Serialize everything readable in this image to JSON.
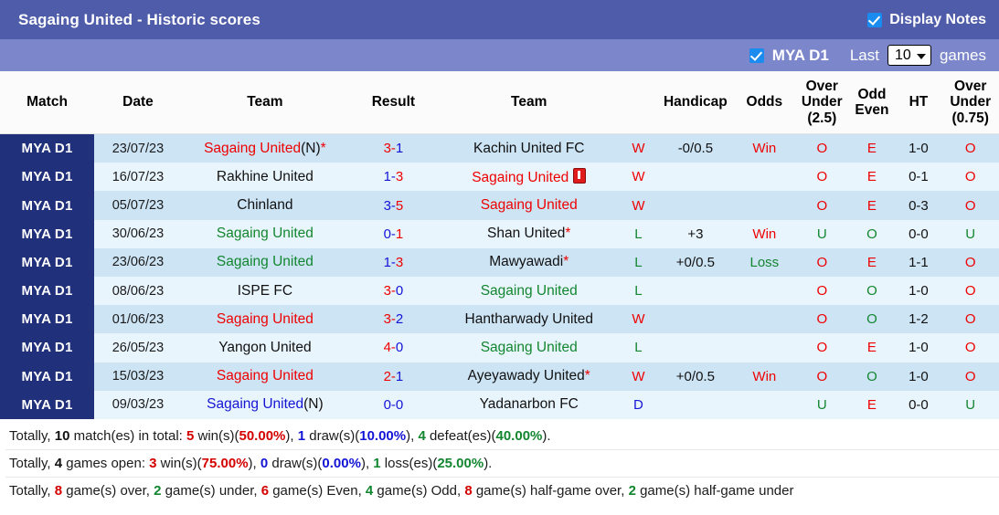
{
  "header": {
    "title": "Sagaing United - Historic scores",
    "display_notes_label": "Display Notes",
    "league_label": "MYA D1",
    "last_label": "Last",
    "games_label": "games",
    "games_count": "10",
    "title_bar_color": "#4e5ca9",
    "sub_bar_color": "#7b86cb",
    "checkbox_color": "#1a8cf0"
  },
  "columns": [
    {
      "label": "Match"
    },
    {
      "label": "Date"
    },
    {
      "label": "Team"
    },
    {
      "label": "Result"
    },
    {
      "label": "Team"
    },
    {
      "label": ""
    },
    {
      "label": "Handicap"
    },
    {
      "label": "Odds"
    },
    {
      "label": "Over\nUnder\n(2.5)",
      "l1": "Over",
      "l2": "Under",
      "l3": "(2.5)"
    },
    {
      "label": "Odd\nEven",
      "l1": "Odd",
      "l2": "Even"
    },
    {
      "label": "HT"
    },
    {
      "label": "Over\nUnder\n(0.75)",
      "l1": "Over",
      "l2": "Under",
      "l3": "(0.75)"
    }
  ],
  "column_labels": {
    "match": "Match",
    "date": "Date",
    "team": "Team",
    "result": "Result",
    "team2": "Team",
    "handicap": "Handicap",
    "odds": "Odds",
    "ou25_1": "Over",
    "ou25_2": "Under",
    "ou25_3": "(2.5)",
    "oddeven_1": "Odd",
    "oddeven_2": "Even",
    "ht": "HT",
    "ou075_1": "Over",
    "ou075_2": "Under",
    "ou075_3": "(0.75)"
  },
  "colors": {
    "red": "#ee0000",
    "green": "#12862f",
    "blue": "#1414d6",
    "black": "#111111",
    "league_cell": "#20307a",
    "row_odd": "#cde4f5",
    "row_even": "#e9f5fd"
  },
  "rows": [
    {
      "league": "MYA D1",
      "date": "23/07/23",
      "home": "Sagaing United",
      "home_color": "red",
      "home_suffix": "(N)",
      "home_suffix_color": "black",
      "home_star": true,
      "home_card": false,
      "score_home": "3",
      "score_away": "1",
      "score_home_color": "red",
      "score_away_color": "blue",
      "away": "Kachin United FC",
      "away_color": "black",
      "away_suffix": "",
      "away_star": false,
      "away_card": false,
      "wdl": "W",
      "wdl_color": "red",
      "handicap": "-0/0.5",
      "odds": "Win",
      "odds_color": "red",
      "ou25": "O",
      "ou25_color": "red",
      "oddeven": "E",
      "oddeven_color": "red",
      "ht": "1-0",
      "ou075": "O",
      "ou075_color": "red"
    },
    {
      "league": "MYA D1",
      "date": "16/07/23",
      "home": "Rakhine United",
      "home_color": "black",
      "home_suffix": "",
      "home_star": false,
      "home_card": false,
      "score_home": "1",
      "score_away": "3",
      "score_home_color": "blue",
      "score_away_color": "red",
      "away": "Sagaing United",
      "away_color": "red",
      "away_suffix": "",
      "away_star": false,
      "away_card": true,
      "wdl": "W",
      "wdl_color": "red",
      "handicap": "",
      "odds": "",
      "odds_color": "black",
      "ou25": "O",
      "ou25_color": "red",
      "oddeven": "E",
      "oddeven_color": "red",
      "ht": "0-1",
      "ou075": "O",
      "ou075_color": "red"
    },
    {
      "league": "MYA D1",
      "date": "05/07/23",
      "home": "Chinland",
      "home_color": "black",
      "home_suffix": "",
      "home_star": false,
      "home_card": false,
      "score_home": "3",
      "score_away": "5",
      "score_home_color": "blue",
      "score_away_color": "red",
      "away": "Sagaing United",
      "away_color": "red",
      "away_suffix": "",
      "away_star": false,
      "away_card": false,
      "wdl": "W",
      "wdl_color": "red",
      "handicap": "",
      "odds": "",
      "odds_color": "black",
      "ou25": "O",
      "ou25_color": "red",
      "oddeven": "E",
      "oddeven_color": "red",
      "ht": "0-3",
      "ou075": "O",
      "ou075_color": "red"
    },
    {
      "league": "MYA D1",
      "date": "30/06/23",
      "home": "Sagaing United",
      "home_color": "green",
      "home_suffix": "",
      "home_star": false,
      "home_card": false,
      "score_home": "0",
      "score_away": "1",
      "score_home_color": "blue",
      "score_away_color": "red",
      "away": "Shan United",
      "away_color": "black",
      "away_suffix": "",
      "away_star": true,
      "away_card": false,
      "wdl": "L",
      "wdl_color": "green",
      "handicap": "+3",
      "odds": "Win",
      "odds_color": "red",
      "ou25": "U",
      "ou25_color": "green",
      "oddeven": "O",
      "oddeven_color": "green",
      "ht": "0-0",
      "ou075": "U",
      "ou075_color": "green"
    },
    {
      "league": "MYA D1",
      "date": "23/06/23",
      "home": "Sagaing United",
      "home_color": "green",
      "home_suffix": "",
      "home_star": false,
      "home_card": false,
      "score_home": "1",
      "score_away": "3",
      "score_home_color": "blue",
      "score_away_color": "red",
      "away": "Mawyawadi",
      "away_color": "black",
      "away_suffix": "",
      "away_star": true,
      "away_card": false,
      "wdl": "L",
      "wdl_color": "green",
      "handicap": "+0/0.5",
      "odds": "Loss",
      "odds_color": "green",
      "ou25": "O",
      "ou25_color": "red",
      "oddeven": "E",
      "oddeven_color": "red",
      "ht": "1-1",
      "ou075": "O",
      "ou075_color": "red"
    },
    {
      "league": "MYA D1",
      "date": "08/06/23",
      "home": "ISPE FC",
      "home_color": "black",
      "home_suffix": "",
      "home_star": false,
      "home_card": false,
      "score_home": "3",
      "score_away": "0",
      "score_home_color": "red",
      "score_away_color": "blue",
      "away": "Sagaing United",
      "away_color": "green",
      "away_suffix": "",
      "away_star": false,
      "away_card": false,
      "wdl": "L",
      "wdl_color": "green",
      "handicap": "",
      "odds": "",
      "odds_color": "black",
      "ou25": "O",
      "ou25_color": "red",
      "oddeven": "O",
      "oddeven_color": "green",
      "ht": "1-0",
      "ou075": "O",
      "ou075_color": "red"
    },
    {
      "league": "MYA D1",
      "date": "01/06/23",
      "home": "Sagaing United",
      "home_color": "red",
      "home_suffix": "",
      "home_star": false,
      "home_card": false,
      "score_home": "3",
      "score_away": "2",
      "score_home_color": "red",
      "score_away_color": "blue",
      "away": "Hantharwady United",
      "away_color": "black",
      "away_suffix": "",
      "away_star": false,
      "away_card": false,
      "wdl": "W",
      "wdl_color": "red",
      "handicap": "",
      "odds": "",
      "odds_color": "black",
      "ou25": "O",
      "ou25_color": "red",
      "oddeven": "O",
      "oddeven_color": "green",
      "ht": "1-2",
      "ou075": "O",
      "ou075_color": "red"
    },
    {
      "league": "MYA D1",
      "date": "26/05/23",
      "home": "Yangon United",
      "home_color": "black",
      "home_suffix": "",
      "home_star": false,
      "home_card": false,
      "score_home": "4",
      "score_away": "0",
      "score_home_color": "red",
      "score_away_color": "blue",
      "away": "Sagaing United",
      "away_color": "green",
      "away_suffix": "",
      "away_star": false,
      "away_card": false,
      "wdl": "L",
      "wdl_color": "green",
      "handicap": "",
      "odds": "",
      "odds_color": "black",
      "ou25": "O",
      "ou25_color": "red",
      "oddeven": "E",
      "oddeven_color": "red",
      "ht": "1-0",
      "ou075": "O",
      "ou075_color": "red"
    },
    {
      "league": "MYA D1",
      "date": "15/03/23",
      "home": "Sagaing United",
      "home_color": "red",
      "home_suffix": "",
      "home_star": false,
      "home_card": false,
      "score_home": "2",
      "score_away": "1",
      "score_home_color": "red",
      "score_away_color": "blue",
      "away": "Ayeyawady United",
      "away_color": "black",
      "away_suffix": "",
      "away_star": true,
      "away_card": false,
      "wdl": "W",
      "wdl_color": "red",
      "handicap": "+0/0.5",
      "odds": "Win",
      "odds_color": "red",
      "ou25": "O",
      "ou25_color": "red",
      "oddeven": "O",
      "oddeven_color": "green",
      "ht": "1-0",
      "ou075": "O",
      "ou075_color": "red"
    },
    {
      "league": "MYA D1",
      "date": "09/03/23",
      "home": "Sagaing United",
      "home_color": "blue",
      "home_suffix": "(N)",
      "home_suffix_color": "black",
      "home_star": false,
      "home_card": false,
      "score_home": "0",
      "score_away": "0",
      "score_home_color": "blue",
      "score_away_color": "blue",
      "away": "Yadanarbon FC",
      "away_color": "black",
      "away_suffix": "",
      "away_star": false,
      "away_card": false,
      "wdl": "D",
      "wdl_color": "blue",
      "handicap": "",
      "odds": "",
      "odds_color": "black",
      "ou25": "U",
      "ou25_color": "green",
      "oddeven": "E",
      "oddeven_color": "red",
      "ht": "0-0",
      "ou075": "U",
      "ou075_color": "green"
    }
  ],
  "footer": {
    "line1": {
      "p1": "Totally, ",
      "n_total": "10",
      "p2": " match(es) in total: ",
      "n_win": "5",
      "p3": " win(s)(",
      "pct_win": "50.00%",
      "p4": "), ",
      "n_draw": "1",
      "p5": " draw(s)(",
      "pct_draw": "10.00%",
      "p6": "), ",
      "n_def": "4",
      "p7": " defeat(es)(",
      "pct_def": "40.00%",
      "p8": ")."
    },
    "line2": {
      "p1": "Totally, ",
      "n_total": "4",
      "p2": " games open: ",
      "n_win": "3",
      "p3": " win(s)(",
      "pct_win": "75.00%",
      "p4": "), ",
      "n_draw": "0",
      "p5": " draw(s)(",
      "pct_draw": "0.00%",
      "p6": "), ",
      "n_loss": "1",
      "p7": " loss(es)(",
      "pct_loss": "25.00%",
      "p8": ")."
    },
    "line3": {
      "p0": "Totally, ",
      "n_over": "8",
      "p1": " game(s) over, ",
      "n_under": "2",
      "p2": " game(s) under, ",
      "n_even": "6",
      "p3": " game(s) Even, ",
      "n_odd": "4",
      "p4": " game(s) Odd, ",
      "n_hgo": "8",
      "p5": " game(s) half-game over, ",
      "n_hgu": "2",
      "p6": " game(s) half-game under"
    }
  }
}
